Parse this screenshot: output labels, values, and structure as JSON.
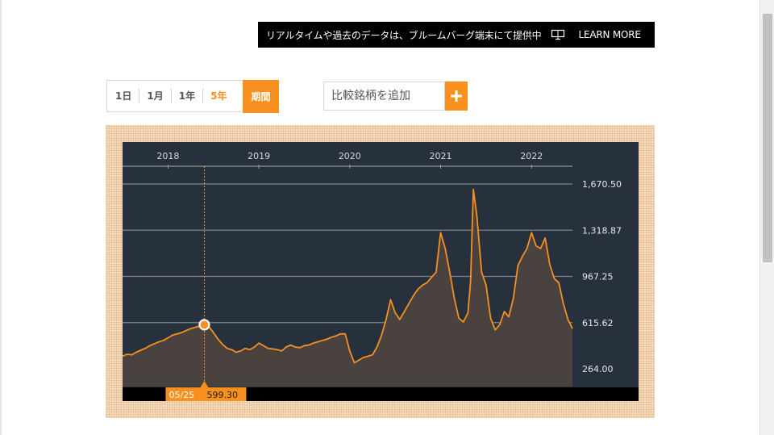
{
  "promo": {
    "text": "リアルタイムや過去のデータは、ブルームバーグ端末にて提供中",
    "icon": "monitor-icon",
    "link_label": "LEARN MORE"
  },
  "range_tabs": [
    {
      "label": "1日",
      "active": false
    },
    {
      "label": "1月",
      "active": false
    },
    {
      "label": "1年",
      "active": false
    },
    {
      "label": "5年",
      "active": true
    }
  ],
  "period_button": "期間",
  "compare": {
    "placeholder": "比較銘柄を追加",
    "add_label": "+"
  },
  "colors": {
    "accent": "#f7901e",
    "chart_bg": "#27313d",
    "area_fill": "#4a423e",
    "gridline": "#7d8288"
  },
  "chart_data": {
    "type": "area",
    "title": "",
    "xlabel": "",
    "ylabel": "",
    "x_ticks": [
      "2018",
      "2019",
      "2020",
      "2021",
      "2022"
    ],
    "y_ticks": [
      "1,670.50",
      "1,318.87",
      "967.25",
      "615.62",
      "264.00"
    ],
    "ylim": [
      220,
      1750
    ],
    "xlim": [
      2017.5,
      2022.45
    ],
    "grid": true,
    "tooltip": {
      "date": "05/25",
      "value": "599.30",
      "x": 2018.4
    },
    "series": [
      {
        "x": [
          2017.5,
          2017.55,
          2017.6,
          2017.65,
          2017.7,
          2017.75,
          2017.8,
          2017.85,
          2017.9,
          2017.95,
          2018.0,
          2018.05,
          2018.1,
          2018.15,
          2018.2,
          2018.25,
          2018.3,
          2018.35,
          2018.4,
          2018.45,
          2018.5,
          2018.55,
          2018.6,
          2018.65,
          2018.7,
          2018.75,
          2018.8,
          2018.85,
          2018.9,
          2018.95,
          2019.0,
          2019.05,
          2019.1,
          2019.15,
          2019.2,
          2019.25,
          2019.3,
          2019.35,
          2019.4,
          2019.45,
          2019.5,
          2019.55,
          2019.6,
          2019.65,
          2019.7,
          2019.75,
          2019.8,
          2019.85,
          2019.9,
          2019.95,
          2020.0,
          2020.05,
          2020.1,
          2020.15,
          2020.2,
          2020.25,
          2020.3,
          2020.35,
          2020.4,
          2020.45,
          2020.5,
          2020.55,
          2020.6,
          2020.65,
          2020.7,
          2020.75,
          2020.8,
          2020.85,
          2020.9,
          2020.95,
          2021.0,
          2021.05,
          2021.1,
          2021.15,
          2021.2,
          2021.25,
          2021.3,
          2021.33,
          2021.36,
          2021.4,
          2021.45,
          2021.5,
          2021.55,
          2021.6,
          2021.65,
          2021.7,
          2021.75,
          2021.8,
          2021.85,
          2021.9,
          2021.95,
          2022.0,
          2022.05,
          2022.1,
          2022.15,
          2022.2,
          2022.25,
          2022.3,
          2022.35,
          2022.4,
          2022.45
        ],
        "values": [
          360,
          375,
          370,
          390,
          405,
          420,
          440,
          455,
          470,
          480,
          500,
          520,
          530,
          540,
          555,
          570,
          580,
          590,
          599,
          585,
          540,
          490,
          450,
          420,
          410,
          390,
          400,
          420,
          410,
          430,
          460,
          440,
          420,
          415,
          410,
          400,
          430,
          445,
          430,
          425,
          440,
          445,
          460,
          470,
          480,
          490,
          505,
          515,
          530,
          530,
          400,
          310,
          330,
          350,
          360,
          370,
          430,
          520,
          640,
          790,
          690,
          640,
          700,
          760,
          820,
          870,
          900,
          920,
          960,
          1000,
          1300,
          1180,
          1000,
          800,
          650,
          620,
          690,
          930,
          1630,
          1420,
          1000,
          900,
          650,
          560,
          600,
          700,
          660,
          800,
          1050,
          1120,
          1180,
          1300,
          1200,
          1180,
          1260,
          1060,
          950,
          920,
          760,
          640,
          570
        ]
      }
    ]
  }
}
